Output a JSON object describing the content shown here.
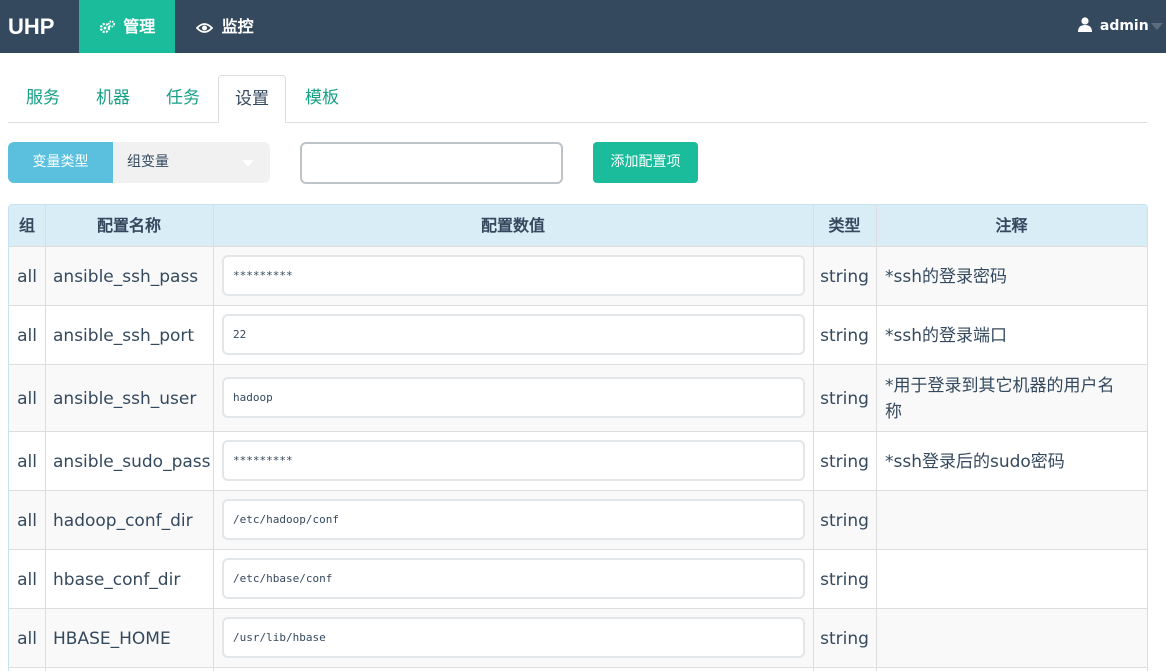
{
  "navbar": {
    "brand": "UHP",
    "manage_label": "管理",
    "monitor_label": "监控",
    "user": "admin"
  },
  "tabs": [
    {
      "label": "服务",
      "active": false
    },
    {
      "label": "机器",
      "active": false
    },
    {
      "label": "任务",
      "active": false
    },
    {
      "label": "设置",
      "active": true
    },
    {
      "label": "模板",
      "active": false
    }
  ],
  "filter": {
    "var_type_label": "变量类型",
    "var_type_value": "组变量",
    "name_input_value": "",
    "add_button": "添加配置项"
  },
  "table": {
    "headers": {
      "group": "组",
      "name": "配置名称",
      "value": "配置数值",
      "type": "类型",
      "note": "注释"
    },
    "rows": [
      {
        "group": "all",
        "name": "ansible_ssh_pass",
        "value": "*********",
        "type": "string",
        "note": "*ssh的登录密码"
      },
      {
        "group": "all",
        "name": "ansible_ssh_port",
        "value": "22",
        "type": "string",
        "note": "*ssh的登录端口"
      },
      {
        "group": "all",
        "name": "ansible_ssh_user",
        "value": "hadoop",
        "type": "string",
        "note": "*用于登录到其它机器的用户名称"
      },
      {
        "group": "all",
        "name": "ansible_sudo_pass",
        "value": "*********",
        "type": "string",
        "note": "*ssh登录后的sudo密码"
      },
      {
        "group": "all",
        "name": "hadoop_conf_dir",
        "value": "/etc/hadoop/conf",
        "type": "string",
        "note": ""
      },
      {
        "group": "all",
        "name": "hbase_conf_dir",
        "value": "/etc/hbase/conf",
        "type": "string",
        "note": ""
      },
      {
        "group": "all",
        "name": "HBASE_HOME",
        "value": "/usr/lib/hbase",
        "type": "string",
        "note": ""
      },
      {
        "group": "",
        "name": "",
        "value": "",
        "type": "",
        "note": ""
      }
    ]
  },
  "colors": {
    "navbar_bg": "#34495e",
    "accent_green": "#1abc9c",
    "info_blue": "#5bc0de",
    "header_bg": "#d9edf7"
  }
}
